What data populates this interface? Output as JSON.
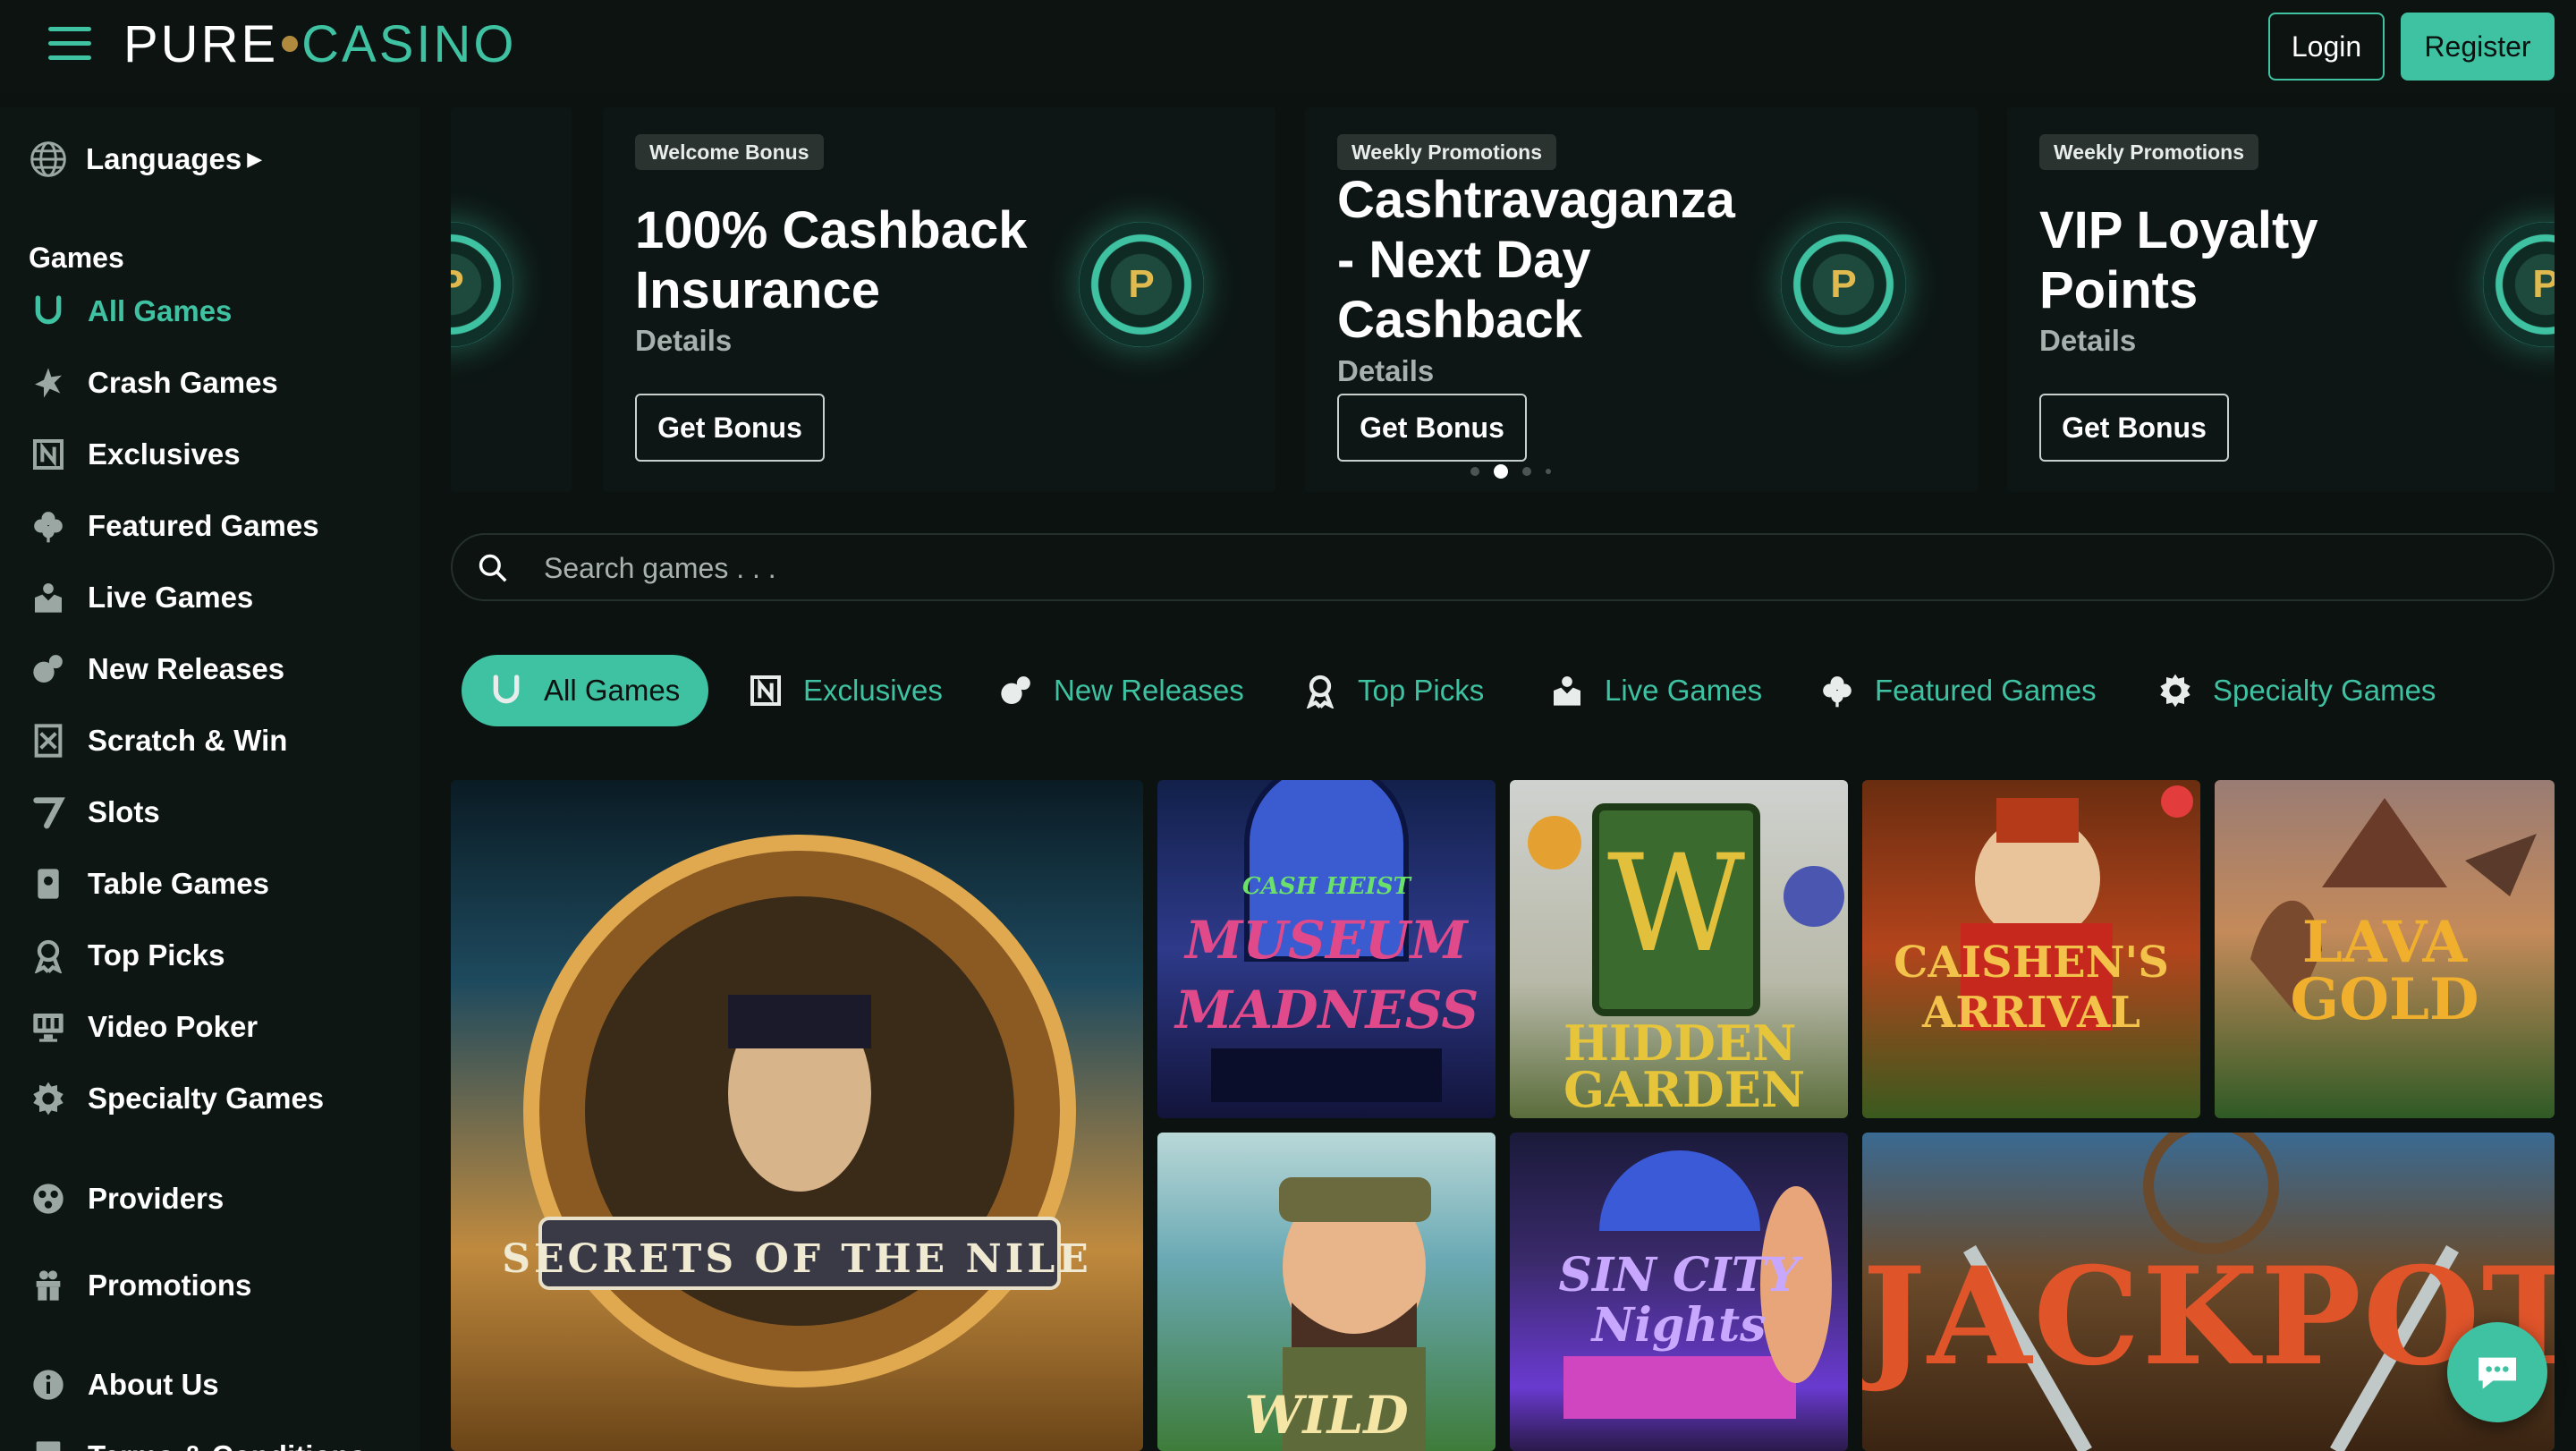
{
  "header": {
    "logo_pure": "PURE",
    "logo_casino": "CASINO",
    "login_label": "Login",
    "register_label": "Register"
  },
  "sidebar": {
    "languages_label": "Languages",
    "section_games": "Games",
    "items": [
      {
        "label": "All Games",
        "icon": "horseshoe-icon",
        "active": true
      },
      {
        "label": "Crash Games",
        "icon": "crash-icon"
      },
      {
        "label": "Exclusives",
        "icon": "exclusive-icon"
      },
      {
        "label": "Featured Games",
        "icon": "clover-icon"
      },
      {
        "label": "Live Games",
        "icon": "live-dealer-icon"
      },
      {
        "label": "New Releases",
        "icon": "new-releases-icon"
      },
      {
        "label": "Scratch & Win",
        "icon": "scratch-card-icon"
      },
      {
        "label": "Slots",
        "icon": "seven-icon"
      },
      {
        "label": "Table Games",
        "icon": "cards-icon"
      },
      {
        "label": "Top Picks",
        "icon": "award-icon"
      },
      {
        "label": "Video Poker",
        "icon": "monitor-icon"
      },
      {
        "label": "Specialty Games",
        "icon": "gear-icon"
      }
    ],
    "providers_label": "Providers",
    "promotions_label": "Promotions",
    "about_label": "About Us",
    "terms_label": "Terms & Conditions"
  },
  "promos": [
    {
      "tag": "Welcome Bonus",
      "title": "100% Cashback Insurance",
      "details": "Details",
      "button": "Get Bonus"
    },
    {
      "tag": "Weekly Promotions",
      "title": "Cashtravaganza - Next Day Cashback",
      "details": "Details",
      "button": "Get Bonus"
    },
    {
      "tag": "Weekly Promotions",
      "title": "VIP Loyalty Points",
      "details": "Details",
      "button": "Get Bonus"
    }
  ],
  "carousel": {
    "active_index": 1,
    "count": 4
  },
  "search": {
    "placeholder": "Search games . . ."
  },
  "tabs": [
    {
      "label": "All Games",
      "icon": "horseshoe-icon",
      "active": true
    },
    {
      "label": "Exclusives",
      "icon": "exclusive-icon"
    },
    {
      "label": "New Releases",
      "icon": "new-releases-icon"
    },
    {
      "label": "Top Picks",
      "icon": "award-icon"
    },
    {
      "label": "Live Games",
      "icon": "live-dealer-icon"
    },
    {
      "label": "Featured Games",
      "icon": "clover-icon"
    },
    {
      "label": "Specialty Games",
      "icon": "gear-icon"
    }
  ],
  "games": [
    {
      "title": "SECRETS OF THE NILE"
    },
    {
      "title_small": "CASH HEIST",
      "title": "MUSEUM MADNESS"
    },
    {
      "title": "HIDDEN GARDEN"
    },
    {
      "title": "CAISHEN'S ARRIVAL"
    },
    {
      "title": "LAVA GOLD"
    },
    {
      "title": "WILD Fishing"
    },
    {
      "title": "SIN CITY Nights"
    },
    {
      "title": "JACKPOT"
    }
  ],
  "colors": {
    "accent": "#3fc2a2",
    "background": "#0b1210",
    "sidebar": "#0e1614"
  }
}
